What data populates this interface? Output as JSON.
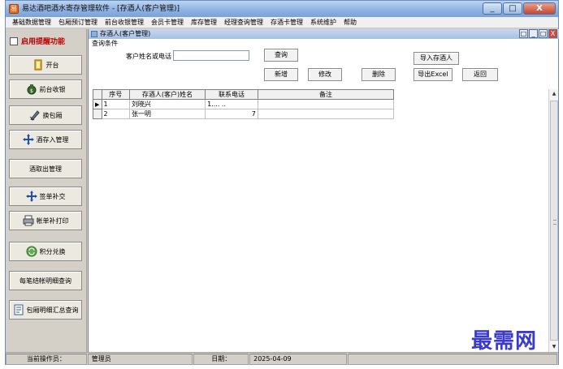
{
  "window": {
    "title": "易达酒吧酒水寄存管理软件 - [存酒人(客户管理)]",
    "app_icon": "易",
    "min": "_",
    "max": "□",
    "close": "X"
  },
  "menu": [
    "基础数据管理",
    "包厢预订管理",
    "前台收银管理",
    "会员卡管理",
    "库存管理",
    "经理查询管理",
    "存酒卡管理",
    "系统维护",
    "帮助"
  ],
  "sidebar": {
    "remind_label": "启用提醒功能",
    "buttons": [
      {
        "label": "开台",
        "icon": "door-icon"
      },
      {
        "label": "前台收银",
        "icon": "money-bag-icon"
      },
      {
        "label": "换包厢",
        "icon": "pencil-icon"
      },
      {
        "label": "酒存入管理",
        "icon": "arrows-icon"
      },
      {
        "label": "酒取出管理",
        "icon": ""
      },
      {
        "label": "签单补交",
        "icon": "arrows-icon"
      },
      {
        "label": "帐单补打印",
        "icon": "printer-icon"
      },
      {
        "label": "积分兑换",
        "icon": "exchange-icon"
      },
      {
        "label": "每笔结帐明细查询",
        "icon": ""
      },
      {
        "label": "包厢明细汇总查询",
        "icon": "document-icon"
      }
    ]
  },
  "inner_window": {
    "title": "存酒人(客户管理)"
  },
  "query": {
    "group_label": "查询条件",
    "field_label": "客户姓名或电话",
    "field_value": "",
    "search_button": "查询",
    "import_button": "导入存酒人",
    "new_button": "新增",
    "edit_button": "修改",
    "delete_button": "删除",
    "export_button": "导出Excel",
    "back_button": "返回"
  },
  "table": {
    "headers": [
      "序号",
      "存酒人(客户)姓名",
      "联系电话",
      "备注"
    ],
    "rows": [
      {
        "marker": "▶",
        "index": "1",
        "name": "刘晓兴",
        "phone": "1.... ..",
        "note": ""
      },
      {
        "marker": "",
        "index": "2",
        "name": "张一明",
        "phone": "7",
        "note": ""
      }
    ]
  },
  "status": {
    "operator_label": "当前操作员：",
    "operator_value": "管理员",
    "date_label": "日期：",
    "date_value": "2025-04-09"
  },
  "watermark": "最需网"
}
